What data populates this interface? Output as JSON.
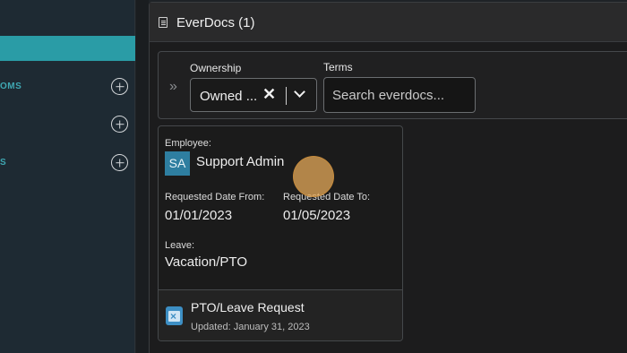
{
  "sidebar": {
    "items": [
      {
        "label": "OMS"
      },
      {
        "label": ""
      },
      {
        "label": "S"
      }
    ]
  },
  "panel": {
    "title": "EverDocs (1)"
  },
  "filters": {
    "ownership_label": "Ownership",
    "ownership_value": "Owned ...",
    "terms_label": "Terms",
    "terms_placeholder": "Search everdocs..."
  },
  "card": {
    "employee_label": "Employee:",
    "avatar_initials": "SA",
    "employee_name": "Support Admin",
    "date_from_label": "Requested Date From:",
    "date_from": "01/01/2023",
    "date_to_label": "Requested Date To:",
    "date_to": "01/05/2023",
    "leave_label": "Leave:",
    "leave_value": "Vacation/PTO",
    "footer_title": "PTO/Leave Request",
    "footer_updated": "Updated: January 31, 2023"
  },
  "colors": {
    "accent": "#2a9ca6",
    "avatar": "#2e7ea0",
    "calendar_icon": "#3d8fc4"
  }
}
